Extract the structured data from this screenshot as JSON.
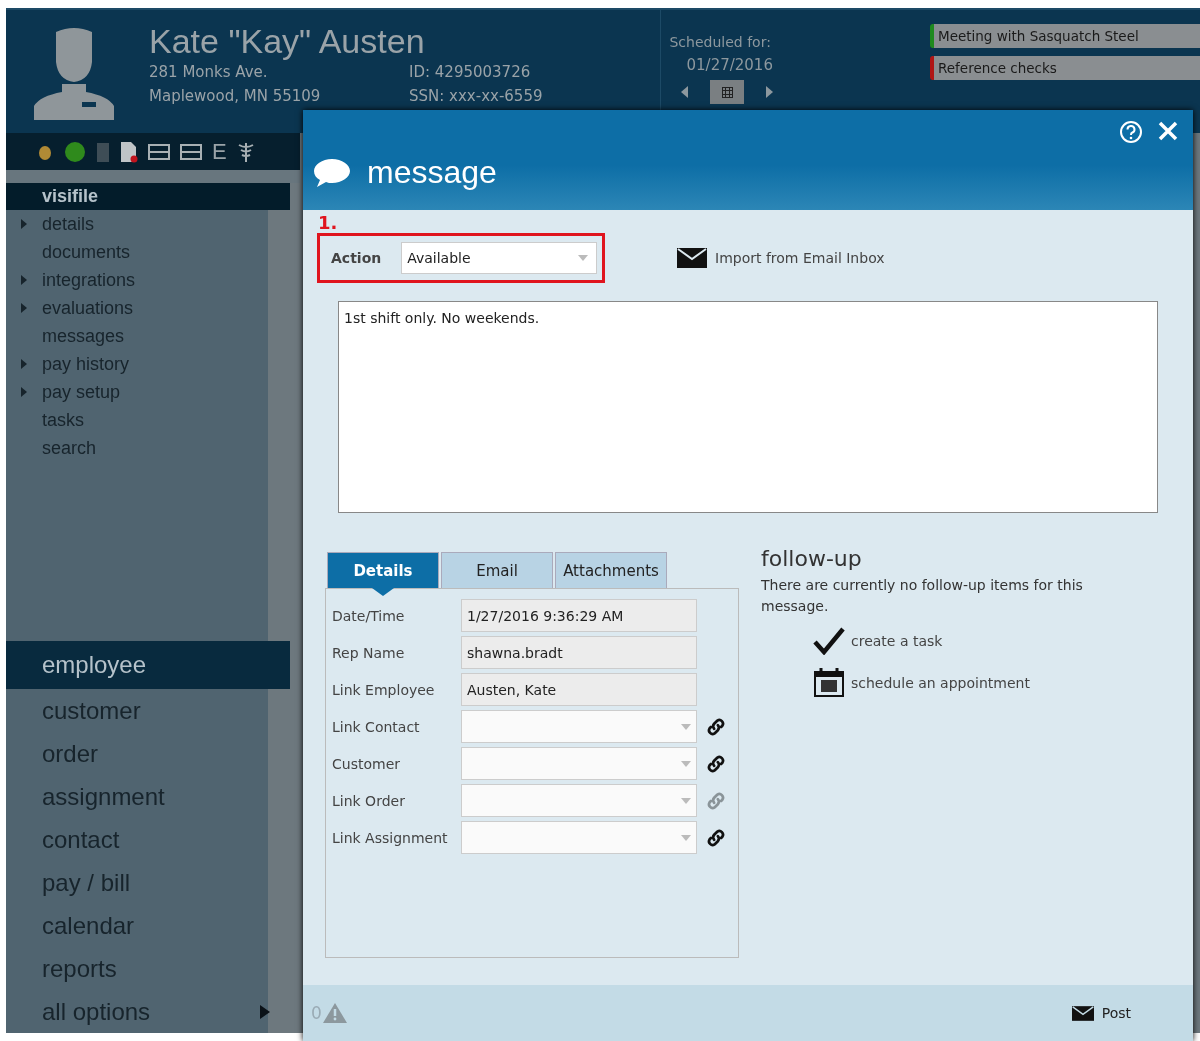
{
  "header": {
    "name": "Kate \"Kay\" Austen",
    "address_line1": "281 Monks Ave.",
    "address_line2": "Maplewood, MN 55109",
    "id": "ID: 4295003726",
    "ssn": "SSN: xxx-xx-6559",
    "scheduled_label": "Scheduled for:",
    "scheduled_date": "01/27/2016",
    "events": [
      {
        "title": "Meeting with Sasquatch Steel",
        "color": "#1e8a1e"
      },
      {
        "title": "Reference checks",
        "color": "#b01515"
      }
    ]
  },
  "toolbar": {
    "letter": "E"
  },
  "sidebar": {
    "title": "visifile",
    "items": [
      {
        "label": "details",
        "expandable": true
      },
      {
        "label": "documents",
        "expandable": false
      },
      {
        "label": "integrations",
        "expandable": true
      },
      {
        "label": "evaluations",
        "expandable": true
      },
      {
        "label": "messages",
        "expandable": false
      },
      {
        "label": "pay history",
        "expandable": true
      },
      {
        "label": "pay setup",
        "expandable": true
      },
      {
        "label": "tasks",
        "expandable": false
      },
      {
        "label": "search",
        "expandable": false
      }
    ]
  },
  "main_nav": [
    {
      "label": "employee",
      "selected": true,
      "submenu": false
    },
    {
      "label": "customer",
      "selected": false,
      "submenu": false
    },
    {
      "label": "order",
      "selected": false,
      "submenu": false
    },
    {
      "label": "assignment",
      "selected": false,
      "submenu": false
    },
    {
      "label": "contact",
      "selected": false,
      "submenu": false
    },
    {
      "label": "pay / bill",
      "selected": false,
      "submenu": false
    },
    {
      "label": "calendar",
      "selected": false,
      "submenu": false
    },
    {
      "label": "reports",
      "selected": false,
      "submenu": false
    },
    {
      "label": "all options",
      "selected": false,
      "submenu": true
    }
  ],
  "dialog": {
    "title": "message",
    "annotation": "1.",
    "action_label": "Action",
    "action_value": "Available",
    "import_link": "Import from Email Inbox",
    "message_text": "1st shift only. No weekends.",
    "tabs": [
      {
        "label": "Details",
        "selected": true
      },
      {
        "label": "Email",
        "selected": false
      },
      {
        "label": "Attachments",
        "selected": false
      }
    ],
    "fields": [
      {
        "label": "Date/Time",
        "kind": "text",
        "value": "1/27/2016 9:36:29 AM"
      },
      {
        "label": "Rep Name",
        "kind": "text",
        "value": "shawna.bradt"
      },
      {
        "label": "Link Employee",
        "kind": "text",
        "value": "Austen, Kate"
      },
      {
        "label": "Link Contact",
        "kind": "dropdown",
        "link_enabled": true
      },
      {
        "label": "Customer",
        "kind": "dropdown",
        "link_enabled": true
      },
      {
        "label": "Link Order",
        "kind": "dropdown",
        "link_enabled": false
      },
      {
        "label": "Link Assignment",
        "kind": "dropdown",
        "link_enabled": true
      }
    ],
    "followup": {
      "title": "follow-up",
      "text": "There are currently no follow-up items for this message.",
      "actions": [
        {
          "label": "create a task",
          "kind": "task"
        },
        {
          "label": "schedule an appointment",
          "kind": "appointment"
        }
      ]
    },
    "footer": {
      "warning_count": "0",
      "post": "Post"
    }
  }
}
